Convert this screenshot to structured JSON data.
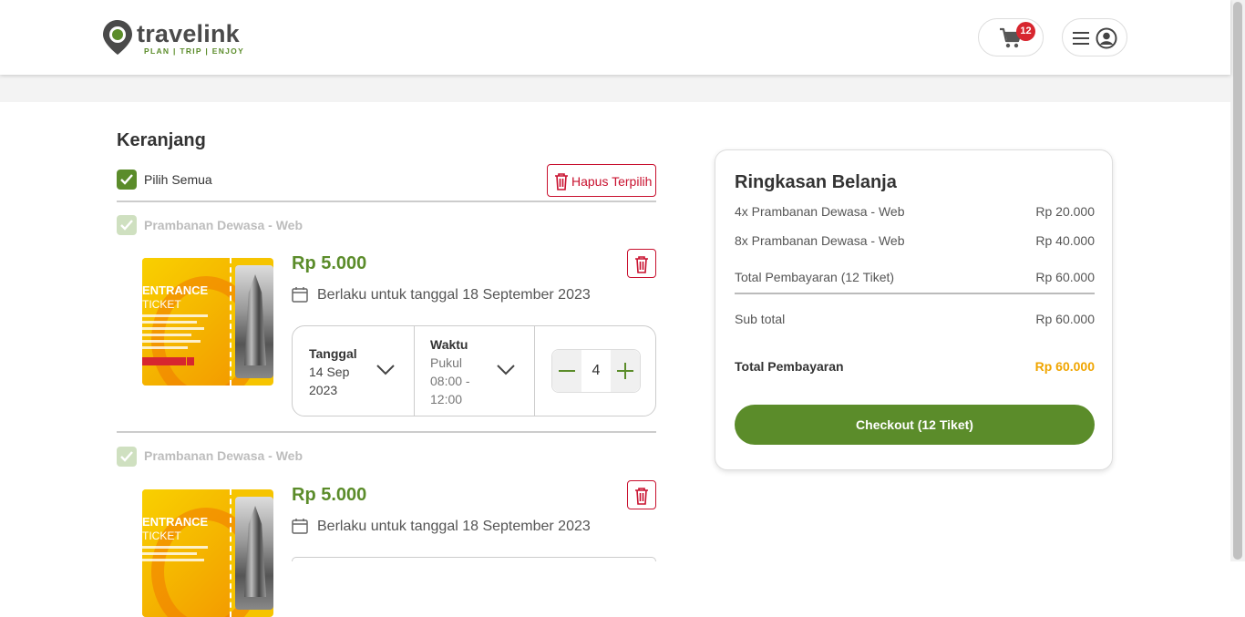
{
  "header": {
    "logo_text": "travelink",
    "logo_tagline": "PLAN | TRIP | ENJOY",
    "cart_count": "12"
  },
  "cart": {
    "title": "Keranjang",
    "select_all_label": "Pilih Semua",
    "delete_selected_label": "Hapus Terpilih",
    "items": [
      {
        "name": "Prambanan Dewasa - Web",
        "ticket_title": "ENTRANCE",
        "ticket_subtitle": "TICKET",
        "price": "Rp 5.000",
        "valid_text": "Berlaku untuk tanggal 18 September 2023",
        "date_label": "Tanggal",
        "date_value": "14 Sep 2023",
        "time_label": "Waktu",
        "time_value": "Pukul 08:00 - 12:00",
        "quantity": "4"
      },
      {
        "name": "Prambanan Dewasa - Web",
        "ticket_title": "ENTRANCE",
        "ticket_subtitle": "TICKET",
        "price": "Rp 5.000",
        "valid_text": "Berlaku untuk tanggal 18 September 2023"
      }
    ]
  },
  "summary": {
    "title": "Ringkasan Belanja",
    "lines": [
      {
        "label": "4x Prambanan Dewasa - Web",
        "value": "Rp 20.000"
      },
      {
        "label": "8x Prambanan Dewasa - Web",
        "value": "Rp 40.000"
      },
      {
        "label": "Total Pembayaran (12 Tiket)",
        "value": "Rp 60.000"
      }
    ],
    "subtotal_label": "Sub total",
    "subtotal_value": "Rp 60.000",
    "total_label": "Total Pembayaran",
    "total_value": "Rp 60.000",
    "checkout_label": "Checkout (12 Tiket)"
  },
  "colors": {
    "brand_green": "#5b8c2a",
    "danger_red": "#c8102e",
    "total_orange": "#f0a500"
  },
  "icons": [
    "map-pin-logo-icon",
    "cart-icon",
    "hamburger-icon",
    "user-circle-icon",
    "checkbox-checked-icon",
    "trash-icon",
    "calendar-icon",
    "chevron-down-icon",
    "minus-icon",
    "plus-icon"
  ]
}
